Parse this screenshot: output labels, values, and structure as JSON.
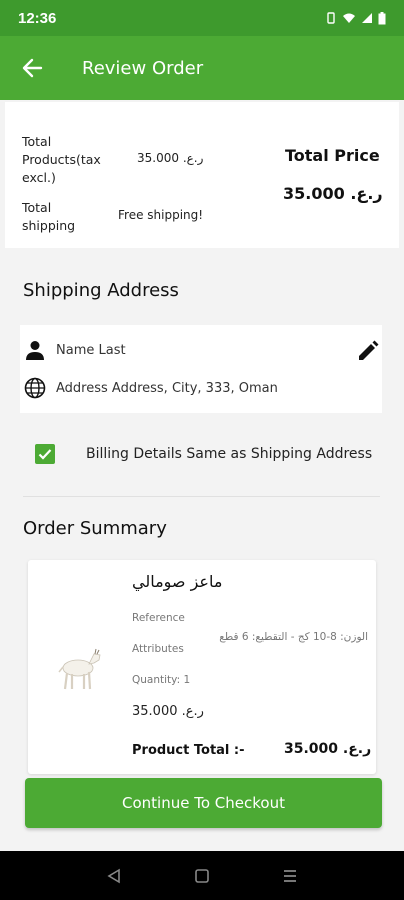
{
  "status_bar": {
    "time": "12:36"
  },
  "app_bar": {
    "title": "Review Order"
  },
  "price_summary": {
    "products_label": "Total Products(tax excl.)",
    "products_value": "ر.ع. 35.000",
    "shipping_label": "Total shipping",
    "shipping_value": "Free shipping!",
    "total_title": "Total Price",
    "total_value": "ر.ع. 35.000"
  },
  "shipping": {
    "heading": "Shipping Address",
    "name": "Name Last",
    "address": "Address Address, City, 333, Oman"
  },
  "billing": {
    "label": "Billing Details Same as Shipping Address",
    "checked": true
  },
  "order_summary": {
    "heading": "Order Summary",
    "product": {
      "name": "ماعز صومالي",
      "reference_label": "Reference",
      "attributes_label": "Attributes",
      "attributes_value": "الوزن: 8-10 كج - التقطيع: 6 قطع",
      "quantity_label": "Quantity: 1",
      "price": "ر.ع. 35.000",
      "total_label": "Product Total :-",
      "total_value": "ر.ع. 35.000"
    }
  },
  "checkout_button": "Continue To Checkout",
  "colors": {
    "primary": "#4caa34",
    "status_bar": "#3e9a2d"
  },
  "icons": [
    "back-arrow-icon",
    "person-icon",
    "globe-icon",
    "edit-pencil-icon",
    "checkmark-icon",
    "nav-back-icon",
    "nav-home-icon",
    "nav-recents-icon"
  ]
}
